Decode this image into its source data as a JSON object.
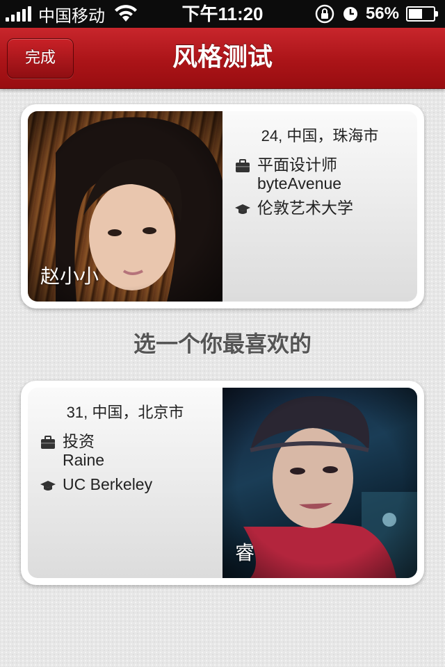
{
  "status_bar": {
    "carrier": "中国移动",
    "time": "下午11:20",
    "battery": "56%",
    "battery_level": 0.56
  },
  "nav": {
    "done_label": "完成",
    "title": "风格测试"
  },
  "prompt": "选一个你最喜欢的",
  "profiles": [
    {
      "name": "赵小小",
      "location": "24, 中国，珠海市",
      "job_title": "平面设计师",
      "company": "byteAvenue",
      "school": "伦敦艺术大学"
    },
    {
      "name": "睿",
      "location": "31, 中国，北京市",
      "job_title": "投资",
      "company": "Raine",
      "school": "UC Berkeley"
    }
  ],
  "icons": {
    "job": "briefcase-icon",
    "school": "graduation-cap-icon"
  },
  "colors": {
    "nav_red": "#b5171c",
    "status_bar": "#0c0c0c",
    "background": "#e7e7e7"
  }
}
